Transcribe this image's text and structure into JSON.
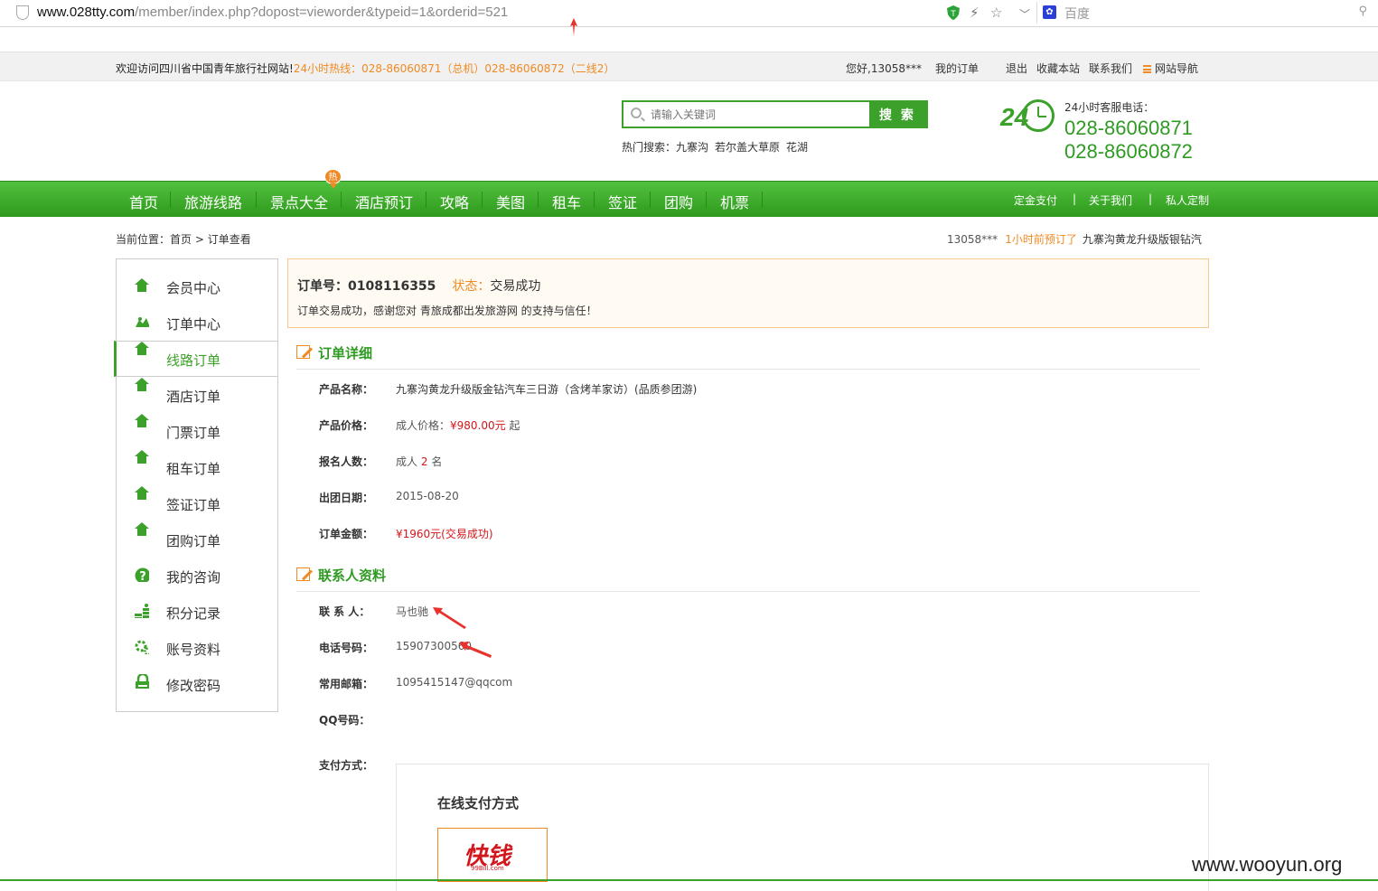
{
  "browser": {
    "url_host": "www.028tty.com",
    "url_path": "/member/index.php?dopost=vieworder&typeid=1&orderid=521",
    "search_engine": "百度"
  },
  "topbar": {
    "welcome": "欢迎访问四川省中国青年旅行社网站!",
    "hotline": "24小时热线：028-86060871（总机）028-86060872（二线2）",
    "greeting": "您好,13058***",
    "my_orders": "我的订单",
    "logout": "退出",
    "favorite": "收藏本站",
    "contact": "联系我们",
    "site_nav": "网站导航"
  },
  "header": {
    "search_placeholder": "请输入关键词",
    "search_button": "搜 索",
    "hot_label": "热门搜索：",
    "hot_terms": [
      "九寨沟",
      "若尔盖大草原",
      "花湖"
    ],
    "service_label": "24小时客服电话：",
    "service_phone_1": "028-86060871",
    "service_phone_2": "028-86060872",
    "clock_number": "24"
  },
  "nav": {
    "items": [
      "首页",
      "旅游线路",
      "景点大全",
      "酒店预订",
      "攻略",
      "美图",
      "租车",
      "签证",
      "团购",
      "机票"
    ],
    "hot_badge": "热",
    "right_items": [
      "定金支付",
      "关于我们",
      "私人定制"
    ],
    "separator": "|"
  },
  "breadcrumb": {
    "label": "当前位置：",
    "home": "首页",
    "sep": " > ",
    "current": "订单查看"
  },
  "recent": {
    "user": "13058***",
    "time": "1小时前预订了",
    "title": "九寨沟黄龙升级版银钻汽"
  },
  "sidebar": {
    "items": [
      {
        "label": "会员中心",
        "icon": "home-icon"
      },
      {
        "label": "订单中心",
        "icon": "map-icon"
      },
      {
        "label": "线路订单",
        "icon": "home-icon"
      },
      {
        "label": "酒店订单",
        "icon": "home-icon"
      },
      {
        "label": "门票订单",
        "icon": "home-icon"
      },
      {
        "label": "租车订单",
        "icon": "home-icon"
      },
      {
        "label": "签证订单",
        "icon": "home-icon"
      },
      {
        "label": "团购订单",
        "icon": "home-icon"
      },
      {
        "label": "我的咨询",
        "icon": "question-icon"
      },
      {
        "label": "积分记录",
        "icon": "coins-icon"
      },
      {
        "label": "账号资料",
        "icon": "gear-icon"
      },
      {
        "label": "修改密码",
        "icon": "lock-icon"
      }
    ],
    "active_index": 2
  },
  "order": {
    "number_label": "订单号：",
    "number": "0108116355",
    "status_label": "状态：",
    "status": "交易成功",
    "message": "订单交易成功，感谢您对 青旅成都出发旅游网 的支持与信任！"
  },
  "detail": {
    "heading": "订单详细",
    "product_name_label": "产品名称：",
    "product_name": "九寨沟黄龙升级版金钻汽车三日游（含烤羊家访）(品质参团游)",
    "price_label": "产品价格：",
    "price_prefix": "成人价格：",
    "price": "¥980.00元",
    "price_suffix": "起",
    "people_label": "报名人数：",
    "people_prefix": "成人",
    "people": "2",
    "people_suffix": "名",
    "date_label": "出团日期：",
    "date": "2015-08-20",
    "amount_label": "订单金额：",
    "amount": "¥1960元(交易成功)"
  },
  "contact": {
    "heading": "联系人资料",
    "name_label": "联 系 人：",
    "name": "马也驰",
    "phone_label": "电话号码：",
    "phone": "15907300560",
    "email_label": "常用邮箱：",
    "email": "1095415147@qqcom",
    "qq_label": "QQ号码：",
    "qq": ""
  },
  "payment": {
    "label": "支付方式：",
    "box_title": "在线支付方式",
    "logo_text": "快钱",
    "logo_sub": "99Bill.com"
  },
  "watermark": "www.wooyun.org",
  "colors": {
    "brand_green": "#3ca12a",
    "accent_orange": "#f08a24",
    "price_red": "#d3161b",
    "annotation_red": "#e8322b"
  }
}
